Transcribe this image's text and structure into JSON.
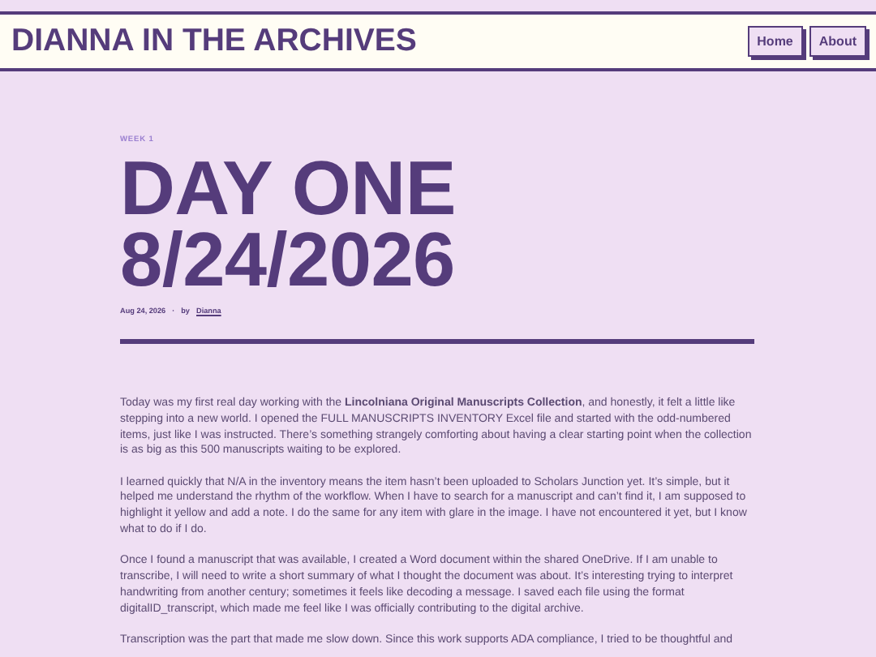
{
  "site_title": "DIANNA IN THE ARCHIVES",
  "nav": [
    {
      "label": "Home"
    },
    {
      "label": "About"
    }
  ],
  "post": {
    "category": "WEEK 1",
    "title": "DAY ONE 8/24/2026",
    "date": "Aug 24, 2026",
    "separator": "·",
    "byline": "by",
    "author": "Dianna",
    "paragraphs": [
      "Today was my first real day working with the **Lincolniana Original Manuscripts Collection**, and honestly, it felt a little like stepping into a new world. I opened the FULL MANUSCRIPTS INVENTORY Excel file and started with the odd-numbered items, just like I was instructed. There’s something strangely comforting about having a clear starting point when the collection is as big as this 500 manuscripts waiting to be explored.",
      "I learned quickly that N/A in the inventory means the item hasn’t been uploaded to Scholars Junction yet. It’s simple, but it helped me understand the rhythm of the workflow. When I have to search for a manuscript and can’t find it, I am supposed to highlight it yellow and add a note. I do the same for any item with glare in the image. I have not encountered it yet, but I know what to do if I do.",
      "Once I found a manuscript that was available, I created a Word document within the shared OneDrive. If I am unable to transcribe, I will need to write a short summary of what I thought the document was about. It’s interesting trying to interpret handwriting from another century; sometimes it feels like decoding a message. I saved each file using the format digitalID_transcript, which made me feel like I was officially contributing to the digital archive.",
      "Transcription was the part that made me slow down. Since this work supports ADA compliance, I tried to be thoughtful and"
    ]
  }
}
